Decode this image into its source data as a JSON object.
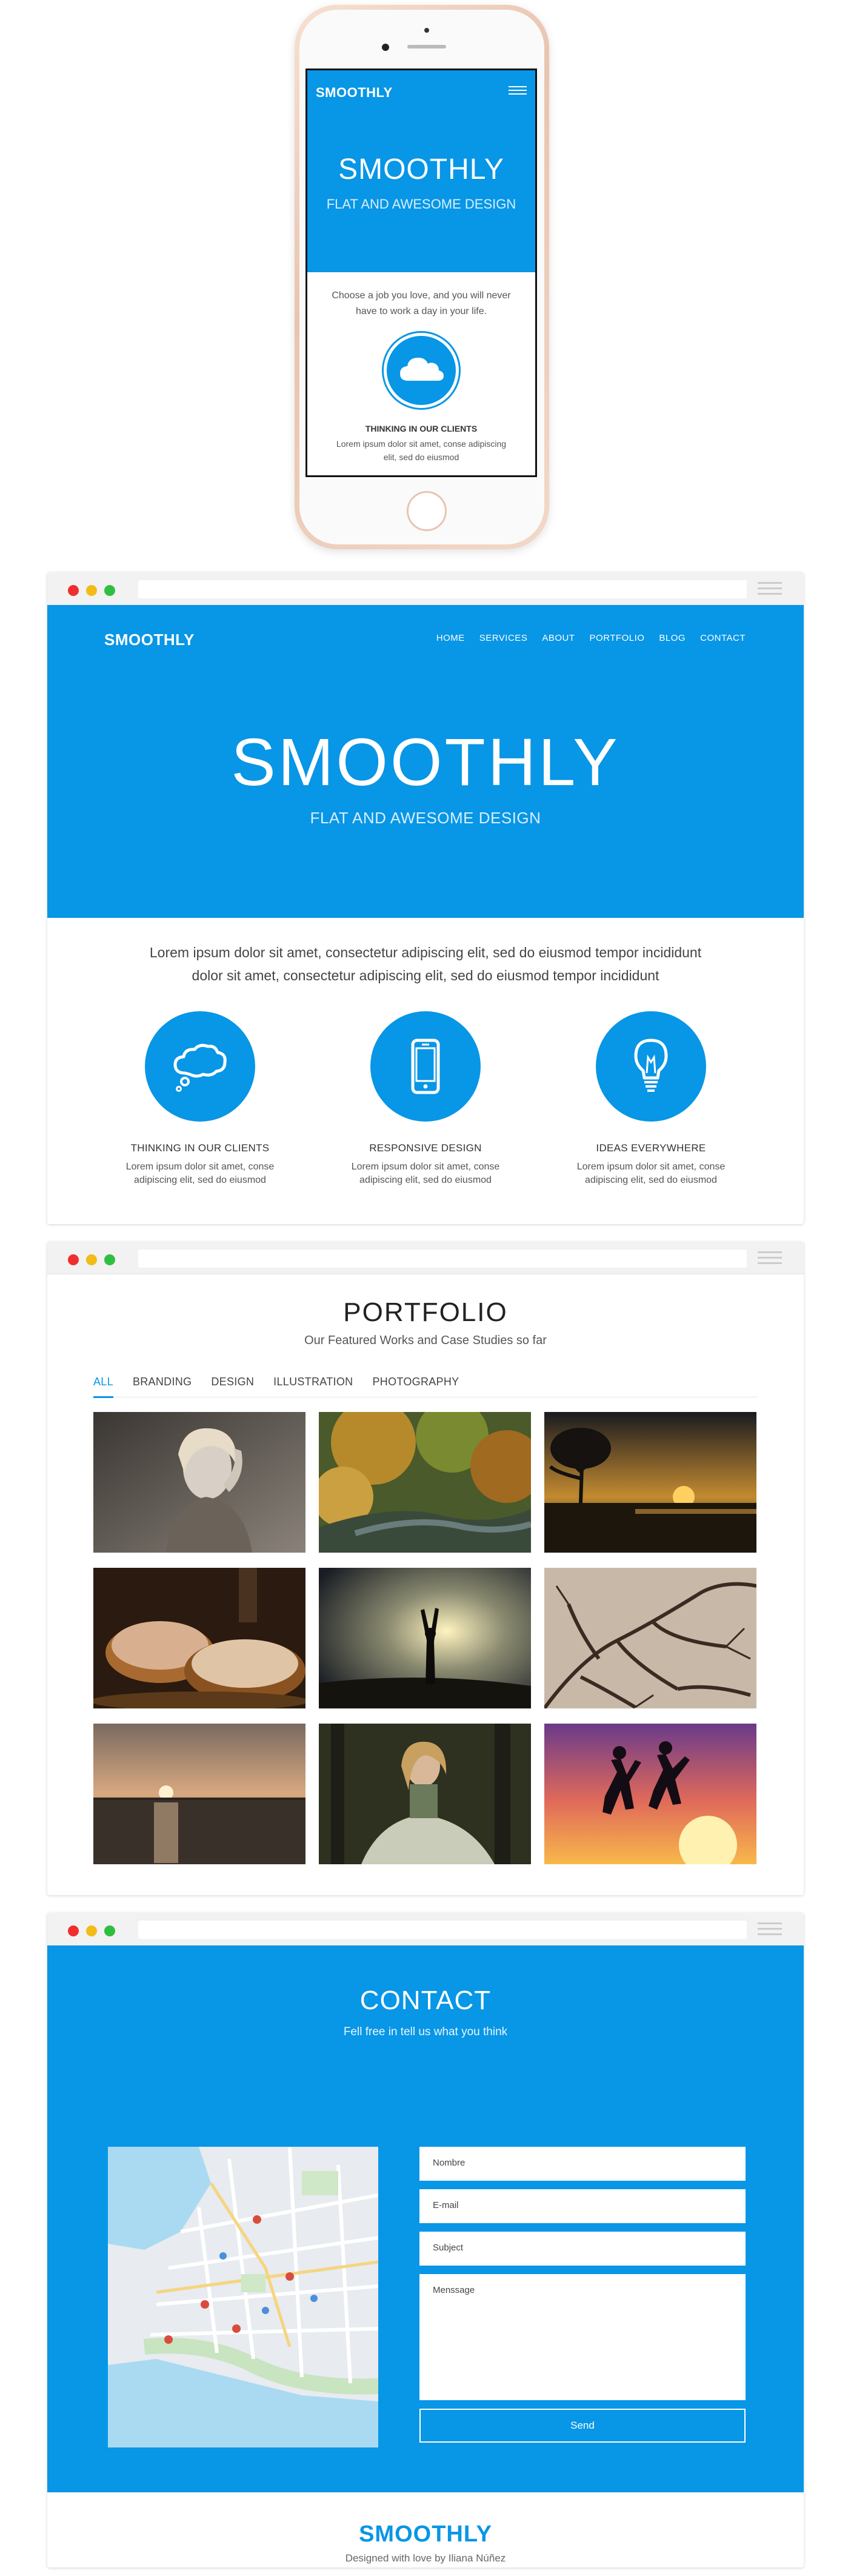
{
  "mobile": {
    "brand": "SMOOTHLY",
    "title": "SMOOTHLY",
    "subtitle": "FLAT AND AWESOME DESIGN",
    "quote": "Choose a job you love, and you will never have to work a day in your life.",
    "feature_title": "THINKING IN OUR CLIENTS",
    "feature_text": "Lorem ipsum dolor sit amet, conse adipiscing elit, sed do eiusmod"
  },
  "home": {
    "brand": "SMOOTHLY",
    "nav": [
      "HOME",
      "SERVICES",
      "ABOUT",
      "PORTFOLIO",
      "BLOG",
      "CONTACT"
    ],
    "title": "SMOOTHLY",
    "subtitle": "FLAT AND AWESOME DESIGN",
    "intro_line1": "Lorem ipsum dolor sit amet, consectetur adipiscing elit, sed do eiusmod tempor incididunt",
    "intro_line2": "dolor sit amet, consectetur adipiscing elit, sed do eiusmod tempor incididunt",
    "features": [
      {
        "icon": "speech-bubble-icon",
        "title": "THINKING IN OUR CLIENTS",
        "text": "Lorem ipsum dolor sit amet, conse adipiscing elit, sed do eiusmod"
      },
      {
        "icon": "smartphone-icon",
        "title": "RESPONSIVE DESIGN",
        "text": "Lorem ipsum dolor sit amet, conse adipiscing elit, sed do eiusmod"
      },
      {
        "icon": "lightbulb-icon",
        "title": "IDEAS EVERYWHERE",
        "text": "Lorem ipsum dolor sit amet, conse adipiscing elit, sed do eiusmod"
      }
    ]
  },
  "portfolio": {
    "title": "PORTFOLIO",
    "subtitle": "Our Featured Works and Case Studies so far",
    "filters": [
      "ALL",
      "BRANDING",
      "DESIGN",
      "ILLUSTRATION",
      "PHOTOGRAPHY"
    ],
    "active_filter": "ALL",
    "photos": [
      "woman-portrait-photo",
      "autumn-stream-photo",
      "sunset-tree-photo",
      "pastries-photo",
      "sky-silhouette-photo",
      "bare-branches-photo",
      "sea-sunset-photo",
      "woman-in-dress-photo",
      "jumping-silhouettes-photo"
    ]
  },
  "contact": {
    "title": "CONTACT",
    "subtitle": "Fell free in tell us what you think",
    "fields": {
      "name": "Nombre",
      "email": "E-mail",
      "subject": "Subject",
      "message": "Menssage"
    },
    "send_label": "Send",
    "footer_brand": "SMOOTHLY",
    "footer_credit": "Designed with love by Iliana Núñez"
  },
  "colors": {
    "accent": "#0896e6"
  }
}
